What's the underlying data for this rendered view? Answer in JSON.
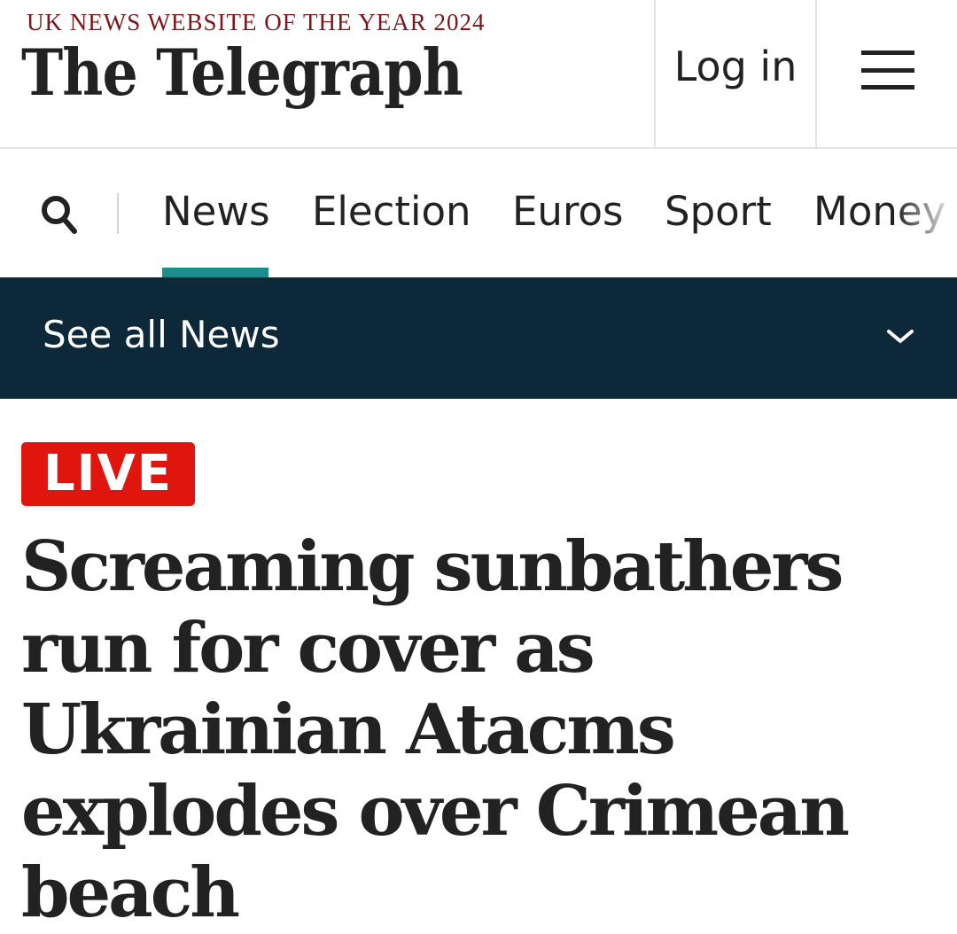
{
  "masthead": {
    "award": "UK NEWS WEBSITE OF THE YEAR 2024",
    "logo": "The Telegraph",
    "login_label": "Log in",
    "menu_icon": "hamburger-menu-icon"
  },
  "nav": {
    "search_icon": "search-icon",
    "items": [
      {
        "label": "News",
        "active": true
      },
      {
        "label": "Election",
        "active": false
      },
      {
        "label": "Euros",
        "active": false
      },
      {
        "label": "Sport",
        "active": false
      },
      {
        "label": "Money",
        "active": false
      }
    ],
    "active_color": "#1d8d8b"
  },
  "subnav": {
    "label": "See all News",
    "icon": "chevron-down-icon",
    "background": "#0c2839"
  },
  "article": {
    "badge": "LIVE",
    "badge_color": "#e0150e",
    "headline": "Screaming sunbathers run for cover as Ukrainian Atacms explodes over Crimean beach"
  }
}
